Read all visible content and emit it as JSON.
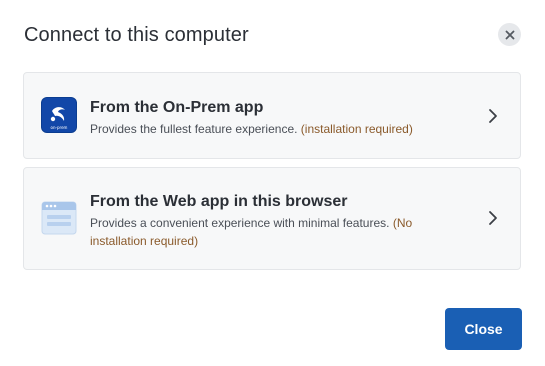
{
  "dialog": {
    "title": "Connect to this computer",
    "close_icon": "close-icon",
    "close_button_label": "Close"
  },
  "options": [
    {
      "title": "From the On-Prem app",
      "description": "Provides the fullest feature experience.",
      "note": "(installation required)",
      "icon": "on-prem-app-icon",
      "icon_caption": "on-prem"
    },
    {
      "title": "From the Web app in this browser",
      "description": "Provides a convenient experience with minimal features.",
      "note": "(No installation required)",
      "icon": "browser-window-icon"
    }
  ],
  "colors": {
    "accent": "#1a5fb4",
    "note": "#8a5a2b",
    "card_background": "#f7f8f9",
    "app_icon_background": "#0b3d91"
  }
}
